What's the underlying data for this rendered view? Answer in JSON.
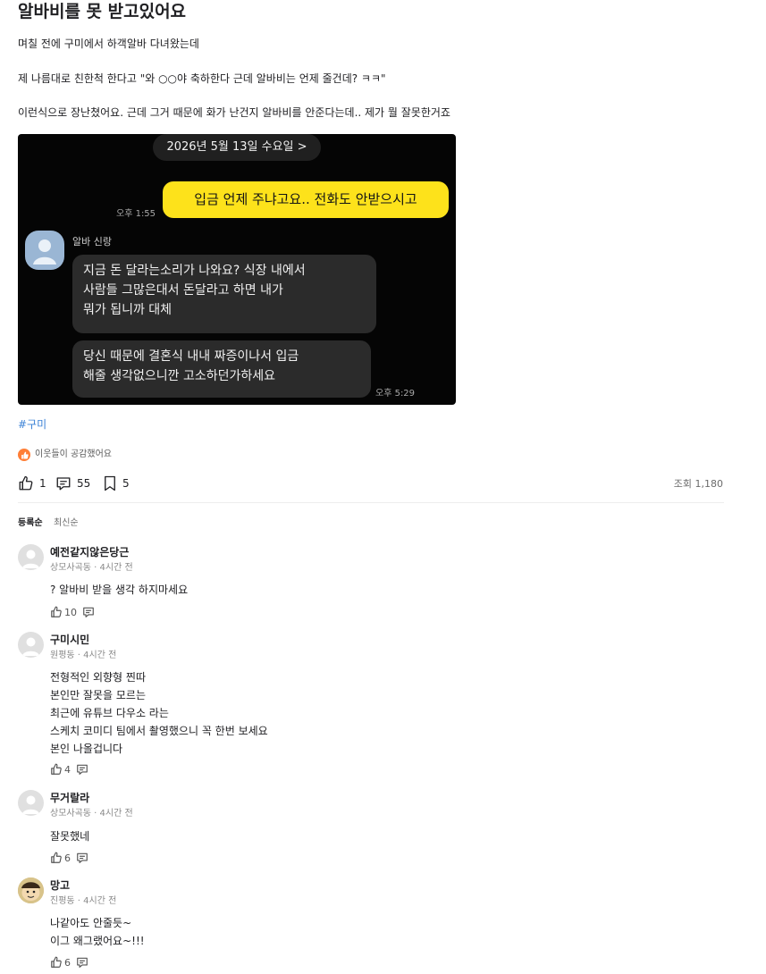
{
  "post": {
    "title": "알바비를 못 받고있어요",
    "paragraphs": [
      "며칠 전에 구미에서 하객알바 다녀왔는데",
      "제 나름대로 친한척 한다고 \"와 ○○야 축하한다 근데 알바비는 언제 줄건데? ㅋㅋ\"",
      "이런식으로 장난쳤어요. 근데 그거 때문에 화가 난건지 알바비를 안준다는데.. 제가 뭘 잘못한거죠"
    ],
    "hashtag": "#구미",
    "reaction_text": "이웃들이 공감했어요",
    "likes": "1",
    "comments_count": "55",
    "bookmarks": "5",
    "views": "조회 1,180"
  },
  "chat": {
    "date": "2026년 5월 13일 수요일 >",
    "my_message": "입금 언제 주냐고요.. 전화도 안받으시고",
    "my_time": "오후 1:55",
    "sender_name": "알바 신랑",
    "other_message1": [
      "지금 돈 달라는소리가 나와요? 식장 내에서",
      "사람들 그많은대서 돈달라고 하면 내가",
      "뭐가 됩니까 대체"
    ],
    "other_message2": [
      "당신 때문에 결혼식 내내 짜증이나서 입금",
      "해줄 생각없으니깐 고소하던가하세요"
    ],
    "other_time": "오후 5:29"
  },
  "sort": {
    "registered": "등록순",
    "latest": "최신순"
  },
  "comments": [
    {
      "author": "예전같지않은당근",
      "meta": "상모사곡동 · 4시간 전",
      "lines": [
        "? 알바비 받을 생각 하지마세요"
      ],
      "likes": "10"
    },
    {
      "author": "구미시민",
      "meta": "원평동 · 4시간 전",
      "lines": [
        "전형적인 외향형 찐따",
        "본인만 잘못을 모르는",
        "최근에 유튜브 다우소 라는",
        "스케치 코미디 팀에서 촬영했으니 꼭 한번 보세요",
        "본인 나올겁니다"
      ],
      "likes": "4"
    },
    {
      "author": "무거랄라",
      "meta": "상모사곡동 · 4시간 전",
      "lines": [
        "잘못했네"
      ],
      "likes": "6"
    },
    {
      "author": "망고",
      "meta": "진평동 · 4시간 전",
      "lines": [
        "나같아도 안줄듯~",
        "이그 왜그랬어요~!!!"
      ],
      "likes": "6"
    }
  ],
  "colors": {
    "accent": "#ff7e36",
    "link": "#3b82d6",
    "kakao_yellow": "#fde21b"
  }
}
